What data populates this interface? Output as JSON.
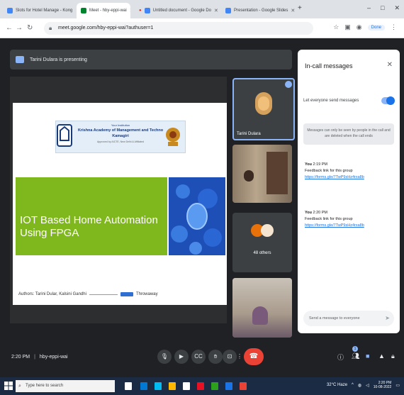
{
  "browser": {
    "tabs": [
      {
        "title": "Slots for Hotel Manage - Kong",
        "favicon_color": "#4285f4",
        "active": false
      },
      {
        "title": "Meet - hby-eppi-wai",
        "favicon_color": "#00832d",
        "active": true
      },
      {
        "title": "Untitled document - Google Do",
        "favicon_color": "#4285f4",
        "active": false
      },
      {
        "title": "Presentation - Google Slides",
        "favicon_color": "#f4b400",
        "active": false
      }
    ],
    "new_tab": "+",
    "window_controls": [
      "–",
      "□",
      "✕"
    ],
    "url": "meet.google.com/hby-eppi-wai?authuser=1",
    "profile_label": "Done"
  },
  "meet": {
    "presenting_banner": "Tarini Dulara is presenting",
    "slide": {
      "institute_line1": "Your Institution",
      "institute_line2": "Krishna Academy of Management and Technology",
      "institute_line3": "Kamagiri",
      "institute_line4": "Approved by AICTE, New Delhi & Affiliated",
      "title": "IOT Based Home Automation Using FPGA",
      "authors_label": "Authors: Tarini Dular, Kalsini Gandhi",
      "trailing_text": "Throwaway"
    },
    "participants": [
      {
        "name": "Tarini Dulara"
      },
      {
        "name": ""
      },
      {
        "name": "48 others"
      },
      {
        "name": ""
      }
    ],
    "chat": {
      "title": "In-call messages",
      "toggle_label": "Let everyone send messages",
      "notice": "Messages can only be seen by people in the call and are deleted when the call ends",
      "messages": [
        {
          "sender": "You",
          "time": "2:19 PM",
          "text": "Feedback link for this group",
          "link": "https://forms.gle/7TwP9sHz4rxa8b"
        },
        {
          "sender": "You",
          "time": "2:20 PM",
          "text": "Feedback link for this group",
          "link": "https://forms.gle/7TwP9sHz4rxa8b"
        }
      ],
      "input_placeholder": "Send a message to everyone",
      "send_icon": "➤"
    },
    "bottom": {
      "time": "2:20 PM",
      "meeting_code": "hby-eppi-wai",
      "participant_count": "1"
    }
  },
  "taskbar": {
    "search_placeholder": "Type here to search",
    "weather": "32°C Haze",
    "time": "2:20 PM",
    "date": "10-08-2022",
    "app_colors": [
      "#ffffff",
      "#0078d4",
      "#00bcf2",
      "#ffb900",
      "#ffffff",
      "#e81123",
      "#2ca01c",
      "#1b73e8",
      "#ea4335"
    ]
  }
}
